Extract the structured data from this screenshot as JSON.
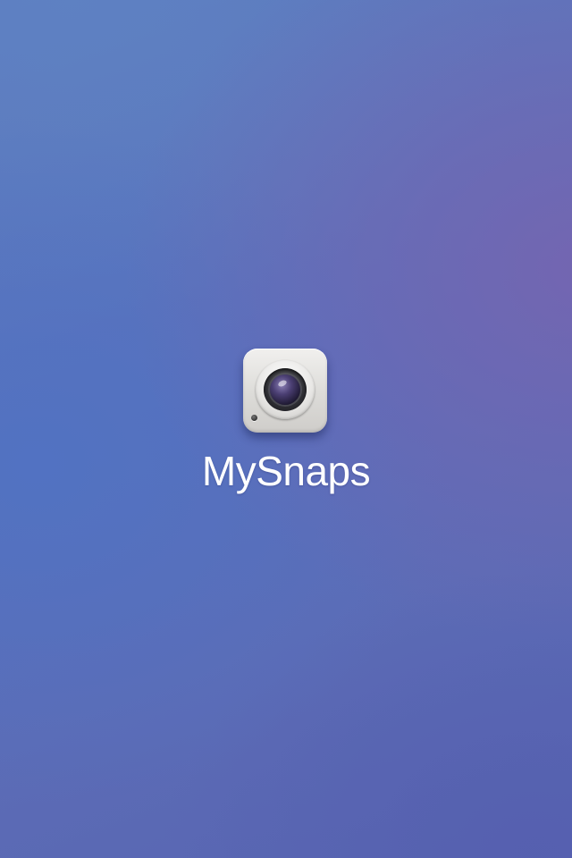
{
  "splash": {
    "app_name": "MySnaps",
    "icon": "camera-icon"
  },
  "colors": {
    "background_top_left": "#5c7dbf",
    "background_right": "#6a68b0",
    "background_bottom": "#5865b2",
    "app_name_text": "#ffffff",
    "icon_body": "#e6e5e2"
  }
}
